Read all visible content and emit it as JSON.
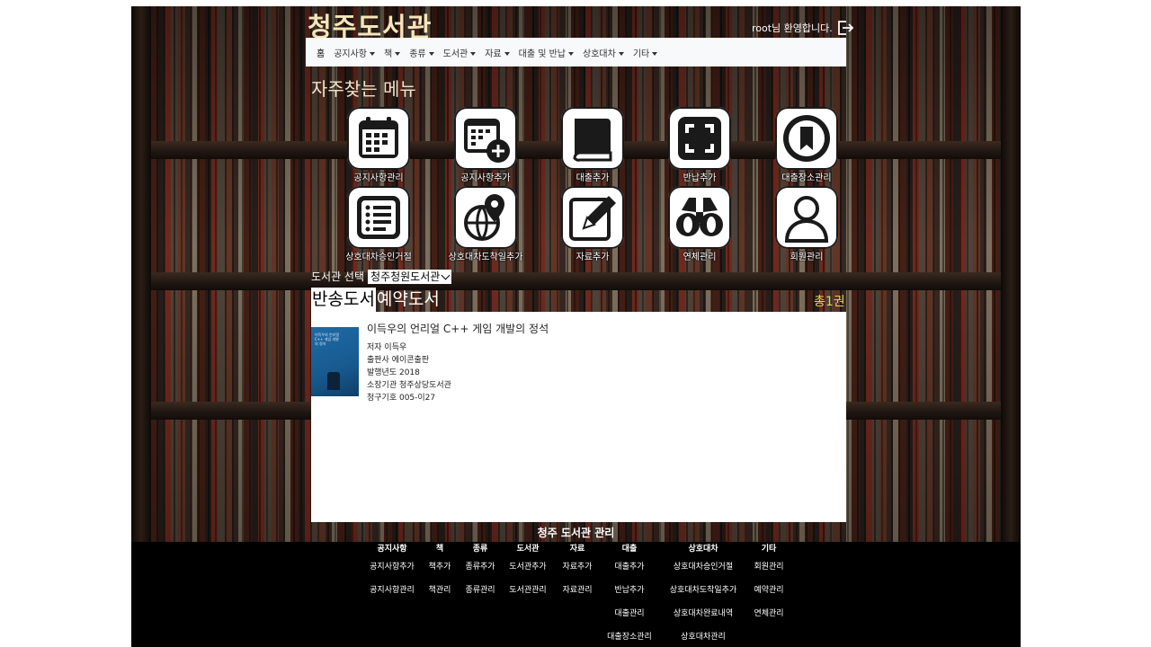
{
  "header": {
    "site_title": "청주도서관",
    "welcome_text": "root님 환영합니다.",
    "logout_icon": "logout-icon"
  },
  "nav": {
    "home": "홈",
    "items": [
      "공지사항",
      "책",
      "종류",
      "도서관",
      "자료",
      "대출 및 반납",
      "상호대차",
      "기타"
    ]
  },
  "frequent_menu": {
    "title": "자주찾는 메뉴",
    "items": [
      {
        "label": "공지사항관리",
        "icon": "calendar-icon"
      },
      {
        "label": "공지사항추가",
        "icon": "calendar-add-icon"
      },
      {
        "label": "대출추가",
        "icon": "book-icon"
      },
      {
        "label": "반납추가",
        "icon": "scan-frame-icon"
      },
      {
        "label": "대출장소관리",
        "icon": "bookmark-circle-icon"
      },
      {
        "label": "상호대차승인거절",
        "icon": "list-icon"
      },
      {
        "label": "상호대차도착일추가",
        "icon": "globe-pin-icon"
      },
      {
        "label": "자료추가",
        "icon": "edit-pencil-icon"
      },
      {
        "label": "연체관리",
        "icon": "binoculars-icon"
      },
      {
        "label": "회원관리",
        "icon": "user-icon"
      }
    ]
  },
  "library_select": {
    "label": "도서관 선택",
    "selected": "주청원도서관",
    "display_prefix": "청"
  },
  "tabs": [
    {
      "label": "반송도서",
      "active": true
    },
    {
      "label": "예약도서",
      "active": false
    }
  ],
  "total_count": "총1권",
  "books": [
    {
      "title": "이득우의 언리얼 C++ 게임 개발의 정석",
      "author_line": "저자 이득우",
      "publisher_line": "출판사 에이콘출판",
      "year_line": "발행년도 2018",
      "holder_line": "소장기관 청주상당도서관",
      "call_number_line": "청구기호 005-이27",
      "cover_text": "이득우의 언리얼 C++ 게임 개발의 정석"
    }
  ],
  "footer": {
    "title": "청주 도서관 관리",
    "columns": [
      {
        "head": "공지사항",
        "links": [
          "공지사항추가",
          "공지사항관리"
        ]
      },
      {
        "head": "책",
        "links": [
          "책추가",
          "책관리"
        ]
      },
      {
        "head": "종류",
        "links": [
          "종류추가",
          "종류관리"
        ]
      },
      {
        "head": "도서관",
        "links": [
          "도서관추가",
          "도서관관리"
        ]
      },
      {
        "head": "자료",
        "links": [
          "자료추가",
          "자료관리"
        ]
      },
      {
        "head": "대출",
        "links": [
          "대출추가",
          "반납추가",
          "대출관리",
          "대출장소관리"
        ]
      },
      {
        "head": "상호대차",
        "links": [
          "상호대차승인거절",
          "상호대차도착일추가",
          "상호대차완료내역",
          "상호대차관리"
        ]
      },
      {
        "head": "기타",
        "links": [
          "회원관리",
          "예약관리",
          "연체관리"
        ]
      }
    ]
  }
}
